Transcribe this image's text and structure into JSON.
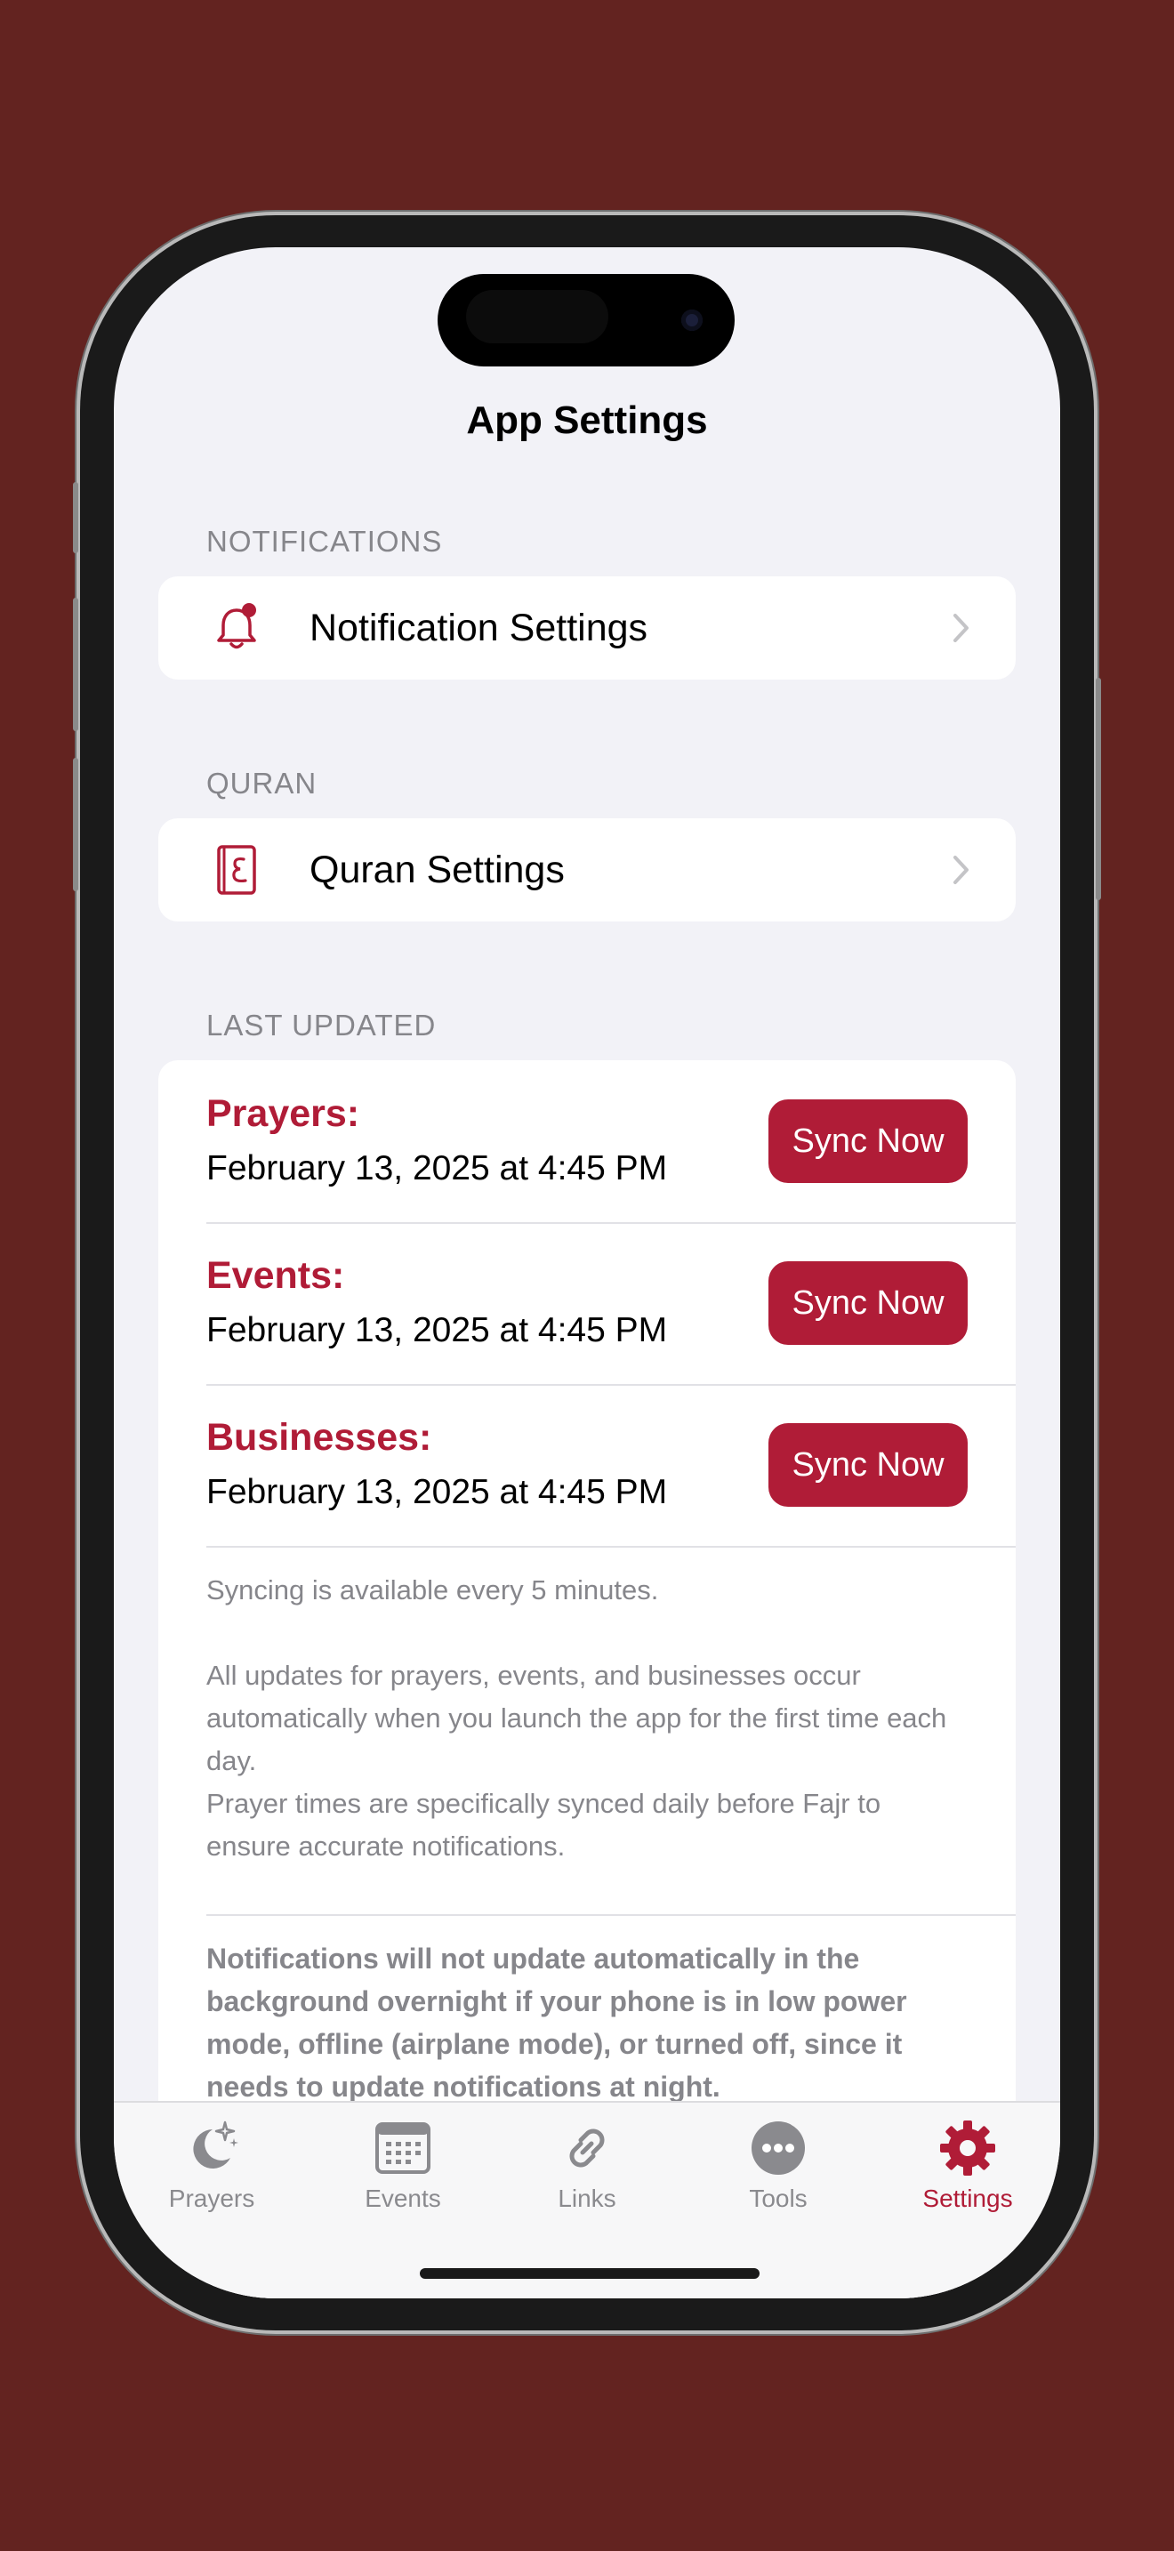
{
  "header": {
    "title": "App Settings"
  },
  "sections": {
    "notifications": {
      "header": "NOTIFICATIONS",
      "item_label": "Notification Settings",
      "icon": "bell-badge-icon"
    },
    "quran": {
      "header": "QURAN",
      "item_label": "Quran Settings",
      "icon": "quran-book-icon"
    },
    "last_updated": {
      "header": "LAST UPDATED",
      "rows": [
        {
          "label": "Prayers:",
          "date": "February 13, 2025 at 4:45 PM",
          "button": "Sync Now"
        },
        {
          "label": "Events:",
          "date": "February 13, 2025 at 4:45 PM",
          "button": "Sync Now"
        },
        {
          "label": "Businesses:",
          "date": "February 13, 2025 at 4:45 PM",
          "button": "Sync Now"
        }
      ],
      "notes": [
        "Syncing is available every 5 minutes.",
        "All updates for prayers, events, and businesses occur automatically when you launch the app for the first time each day.",
        "Prayer times are specifically synced daily before Fajr to ensure accurate notifications."
      ],
      "warning": "Notifications will not update automatically in the background overnight if your phone is in low power mode, offline (airplane mode), or turned off, since it needs to update notifications at night."
    }
  },
  "tabbar": {
    "tabs": [
      {
        "label": "Prayers",
        "icon": "moon-stars-icon"
      },
      {
        "label": "Events",
        "icon": "calendar-icon"
      },
      {
        "label": "Links",
        "icon": "link-icon"
      },
      {
        "label": "Tools",
        "icon": "ellipsis-circle-icon"
      },
      {
        "label": "Settings",
        "icon": "gear-icon"
      }
    ],
    "active": "Settings"
  },
  "colors": {
    "accent": "#b01c37",
    "background": "#632320",
    "screen_bg": "#f2f2f7"
  }
}
